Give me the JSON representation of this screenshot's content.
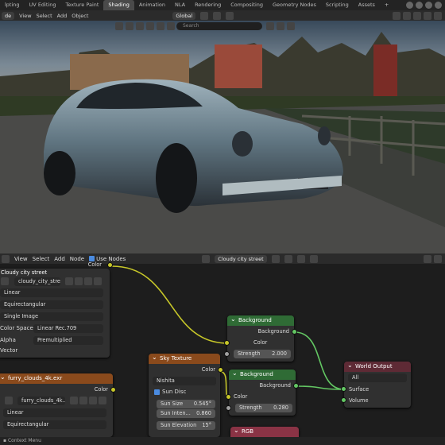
{
  "workspace_tabs": [
    "lpting",
    "UV Editing",
    "Texture Paint",
    "Shading",
    "Animation",
    "NLA",
    "Rendering",
    "Compositing",
    "Geometry Nodes",
    "Scripting",
    "Assets"
  ],
  "active_tab": "Shading",
  "viewport_header": {
    "mode": "de",
    "menus": [
      "View",
      "Select",
      "Add",
      "Object"
    ],
    "orientation": "Global",
    "search_placeholder": "Search"
  },
  "node_header": {
    "menus": [
      "View",
      "Select",
      "Add",
      "Node"
    ],
    "use_nodes_label": "Use Nodes",
    "world_name": "Cloudy city street"
  },
  "env_texture_node": {
    "title": "Cloudy city street",
    "output": "Color",
    "image": "cloudy_city_stre...",
    "interpolation": "Linear",
    "projection": "Equirectangular",
    "source": "Single Image",
    "color_space_label": "Color Space",
    "color_space_value": "Linear Rec.709",
    "alpha_label": "Alpha",
    "alpha_value": "Premultiplied",
    "vector_label": "Vector"
  },
  "clouds_node": {
    "title": "furry_clouds_4k.exr",
    "output": "Color",
    "image": "furry_clouds_4k....",
    "interpolation": "Linear",
    "projection": "Equirectangular"
  },
  "background1": {
    "title": "Background",
    "output": "Background",
    "color_label": "Color",
    "strength_label": "Strength",
    "strength_value": "2.000"
  },
  "background2": {
    "title": "Background",
    "output": "Background",
    "color_label": "Color",
    "strength_label": "Strength",
    "strength_value": "0.280"
  },
  "sky_texture": {
    "title": "Sky Texture",
    "output": "Color",
    "type": "Nishita",
    "sun_disc_label": "Sun Disc",
    "sun_size_label": "Sun Size",
    "sun_size_value": "0.545°",
    "sun_intensity_label": "Sun Inten...",
    "sun_intensity_value": "0.860",
    "sun_elevation_label": "Sun Elevation",
    "sun_elevation_value": "15°"
  },
  "world_output": {
    "title": "World Output",
    "target": "All",
    "surface_label": "Surface",
    "volume_label": "Volume"
  },
  "rgb_node": {
    "title": "RGB"
  },
  "status_bar": {
    "text": "Context Menu"
  },
  "colors": {
    "socket_color": "#c7c729",
    "socket_shader": "#63c763",
    "wire": "#c7c729"
  }
}
